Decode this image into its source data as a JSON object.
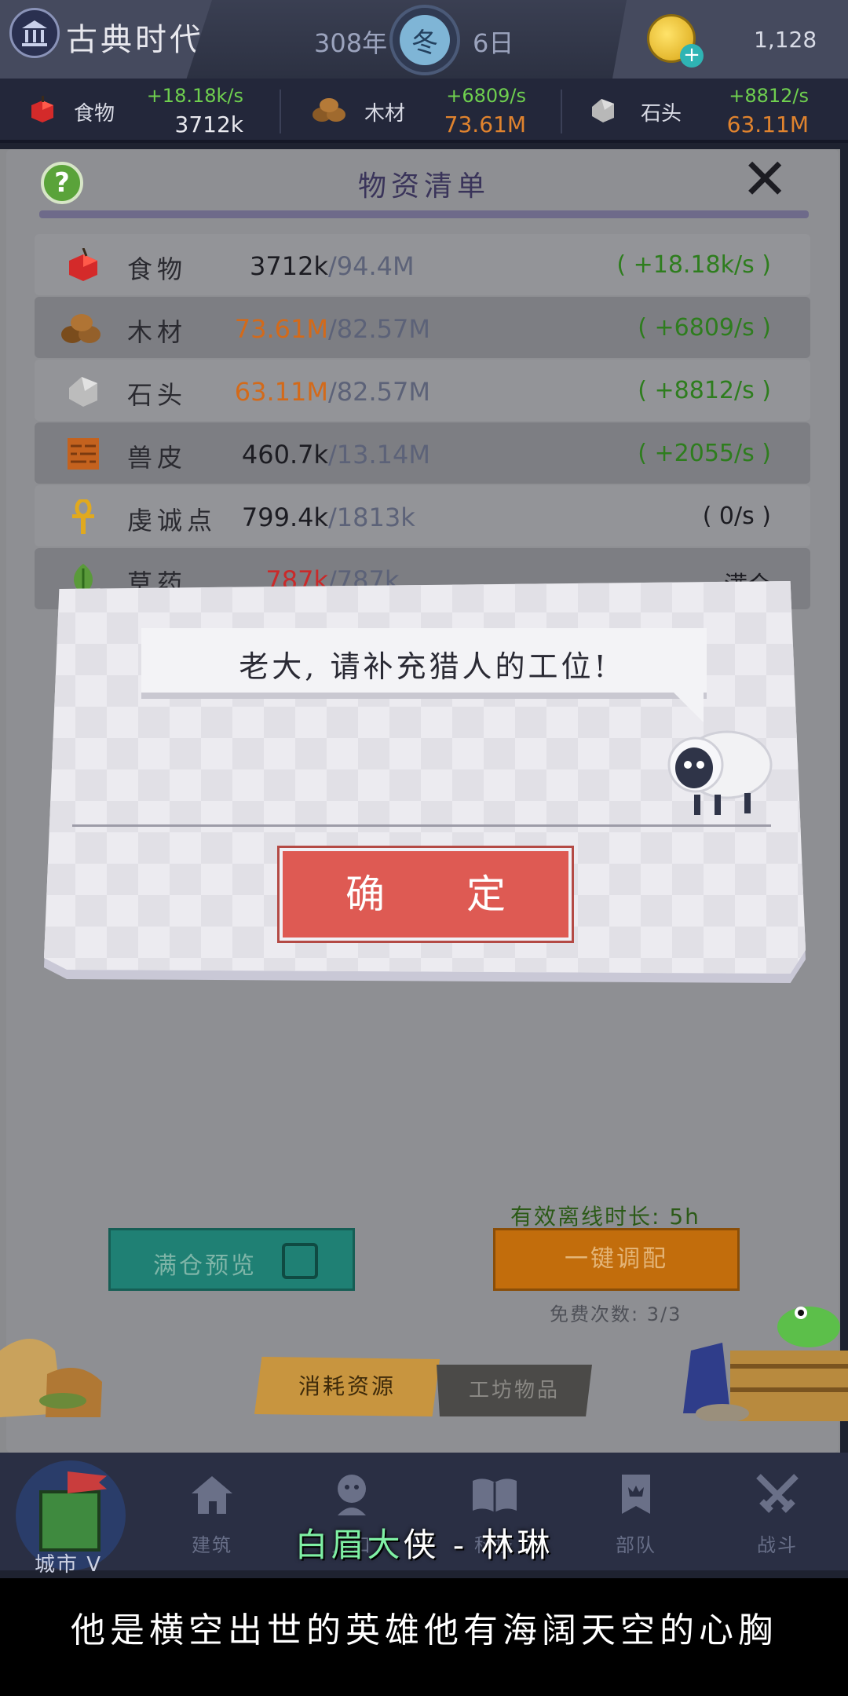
{
  "top": {
    "era": "古典时代",
    "year": "308年",
    "season": "冬",
    "day": "6日",
    "gold": "1,128"
  },
  "resources": [
    {
      "name": "食物",
      "rate": "+18.18k/s",
      "amount": "3712k",
      "icon": "apple-icon"
    },
    {
      "name": "木材",
      "rate": "+6809/s",
      "amount": "73.61M",
      "icon": "wood-icon"
    },
    {
      "name": "石头",
      "rate": "+8812/s",
      "amount": "63.11M",
      "icon": "stone-icon"
    }
  ],
  "panel": {
    "title": "物资清单",
    "rows": [
      {
        "name": "食物",
        "current": "3712k",
        "cap": "/94.4M",
        "rate": "( +18.18k/s )",
        "icon": "apple-icon"
      },
      {
        "name": "木材",
        "current": "73.61M",
        "cap": "/82.57M",
        "rate": "( +6809/s )",
        "icon": "wood-icon"
      },
      {
        "name": "石头",
        "current": "63.11M",
        "cap": "/82.57M",
        "rate": "( +8812/s )",
        "icon": "stone-icon"
      },
      {
        "name": "兽皮",
        "current": "460.7k",
        "cap": "/13.14M",
        "rate": "( +2055/s )",
        "icon": "hide-icon"
      },
      {
        "name": "虔诚点",
        "current": "799.4k",
        "cap": "/1813k",
        "rate": "( 0/s )",
        "icon": "ankh-icon"
      },
      {
        "name": "草药",
        "current": "787k",
        "cap": "/787k",
        "rate": "满仓",
        "icon": "herb-icon"
      }
    ],
    "offline_label": "有效离线时长: 5h",
    "full_preview_label": "满仓预览",
    "dispatch_label": "一键调配",
    "free_count": "免费次数: 3/3",
    "tab_consume": "消耗资源",
    "tab_workshop": "工坊物品"
  },
  "dialog": {
    "message": "老大, 请补充猎人的工位!",
    "confirm_label": "确 定"
  },
  "nav": [
    {
      "label": "城市 V",
      "icon": "castle-icon"
    },
    {
      "label": "建筑",
      "icon": "house-icon"
    },
    {
      "label": "人口",
      "icon": "person-icon"
    },
    {
      "label": "科技",
      "icon": "book-icon"
    },
    {
      "label": "部队",
      "icon": "banner-icon"
    },
    {
      "label": "战斗",
      "icon": "swords-icon"
    }
  ],
  "subtitle": {
    "name_green": "白眉大",
    "name_rest": "侠 - 林琳",
    "line": "他是横空出世的英雄他有海阔天空的心胸"
  },
  "colors": {
    "rate_green": "#6fd04f",
    "orange_amount": "#e0832e",
    "confirm_red": "#de5a53",
    "preview_teal": "#1f8074",
    "dispatch_orange": "#c26d0c"
  }
}
